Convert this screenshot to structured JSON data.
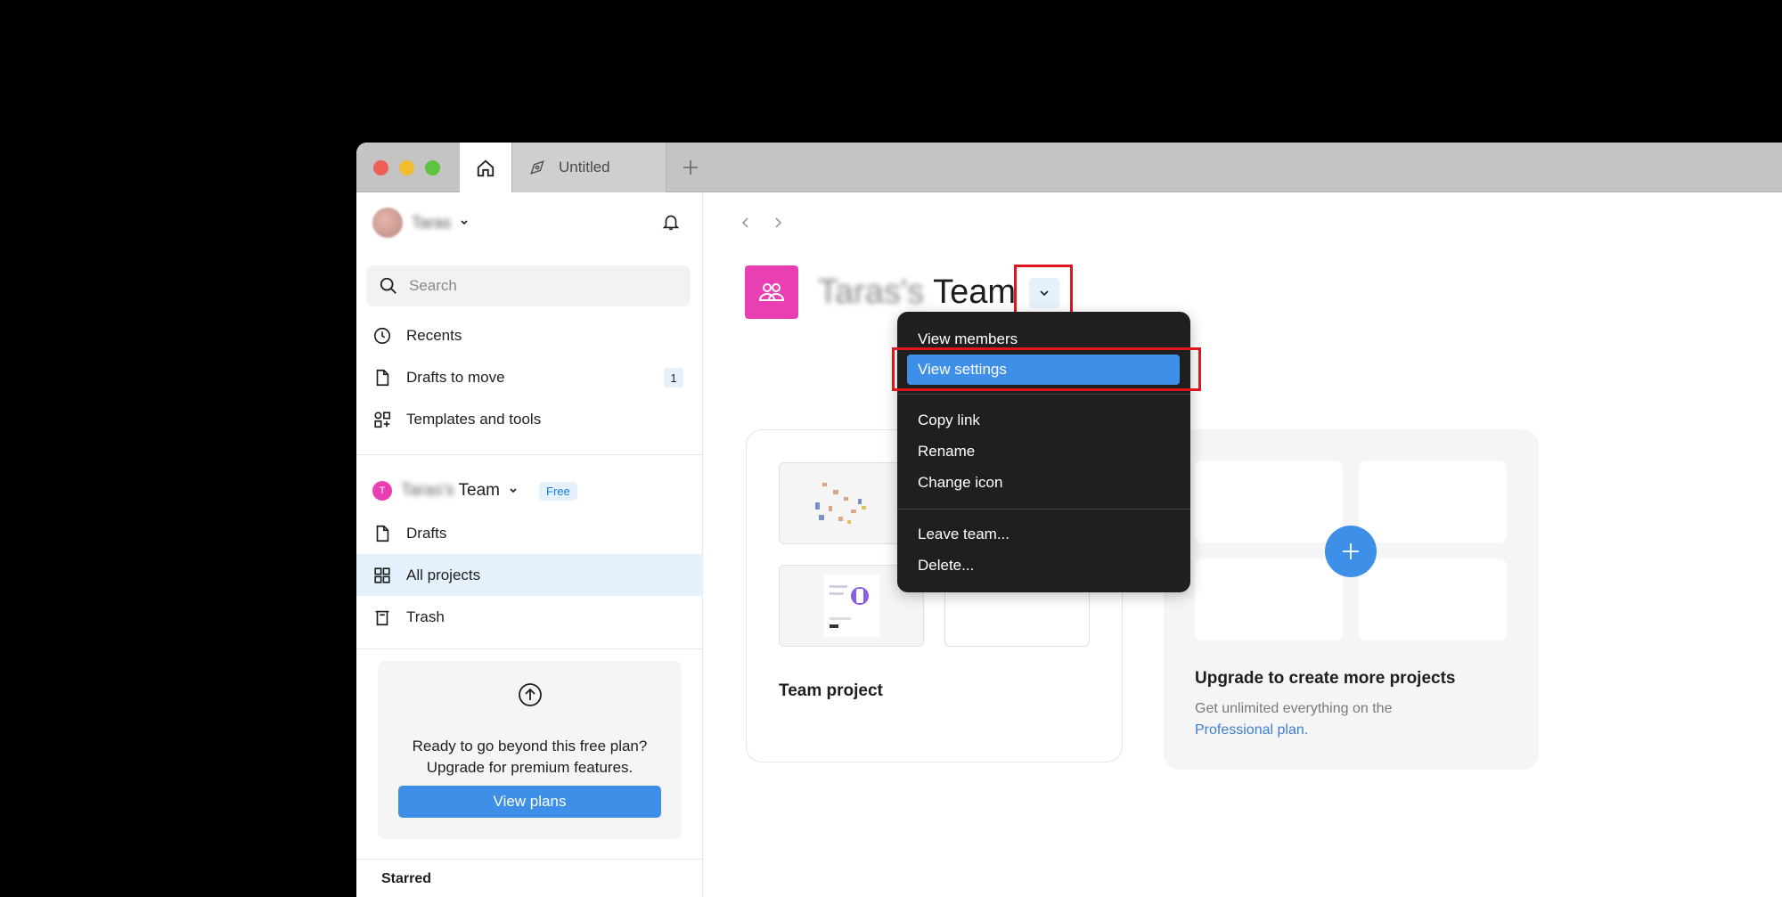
{
  "tabs": {
    "home_icon": "home-icon",
    "untitled_label": "Untitled",
    "add_icon": "plus-icon"
  },
  "sidebar": {
    "user_name": "Taras",
    "search_placeholder": "Search",
    "nav": [
      {
        "label": "Recents",
        "icon": "clock-icon"
      },
      {
        "label": "Drafts to move",
        "icon": "file-icon",
        "count": "1"
      },
      {
        "label": "Templates and tools",
        "icon": "shapes-icon"
      }
    ],
    "team": {
      "name_prefix": "Taras's",
      "name": "Team",
      "badge": "Free",
      "initial": "T"
    },
    "team_nav": [
      {
        "label": "Drafts",
        "icon": "file-icon"
      },
      {
        "label": "All projects",
        "icon": "grid-icon"
      },
      {
        "label": "Trash",
        "icon": "trash-icon"
      }
    ],
    "upgrade": {
      "line1": "Ready to go beyond this free plan?",
      "line2": "Upgrade for premium features.",
      "button": "View plans"
    },
    "starred_heading": "Starred"
  },
  "main": {
    "title_prefix": "Taras's",
    "title": "Team",
    "project_name": "Team project",
    "upgrade_title": "Upgrade to create more projects",
    "upgrade_sub": "Get unlimited everything on the",
    "upgrade_link": "Professional plan."
  },
  "menu": {
    "items": [
      "View members",
      "View settings",
      "Copy link",
      "Rename",
      "Change icon",
      "Leave team...",
      "Delete..."
    ],
    "selected": "View settings"
  },
  "colors": {
    "accent": "#3d8fe8",
    "team_pink": "#e93fb2",
    "highlight_red": "#e0161e"
  }
}
